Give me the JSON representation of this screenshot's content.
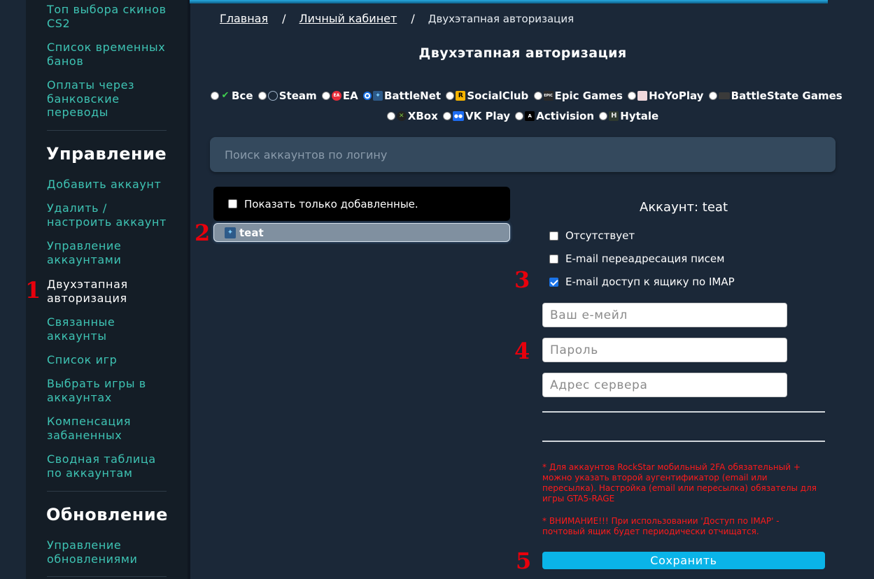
{
  "sidebar": {
    "links_top": [
      "Топ выбора скинов CS2",
      "Список временных банов",
      "Оплаты через банковские переводы"
    ],
    "heading_manage": "Управление",
    "links_manage": [
      "Добавить аккаунт",
      "Удалить / настроить аккаунт",
      "Управление аккаунтами",
      "Двухэтапная авторизация",
      "Связанные аккаунты",
      "Список игр",
      "Выбрать игры в аккаунтах",
      "Компенсация забаненных",
      "Сводная таблица по аккаунтам"
    ],
    "heading_update": "Обновление",
    "links_update": [
      "Управление обновлениями"
    ]
  },
  "markers": [
    "1",
    "2",
    "3",
    "4",
    "5"
  ],
  "breadcrumb": {
    "home": "Главная",
    "cabinet": "Личный кабинет",
    "separator": "/",
    "current": "Двухэтапная авторизация"
  },
  "page_title": "Двухэтапная авторизация",
  "platforms": {
    "row1": [
      "Все",
      "Steam",
      "EA",
      "BattleNet",
      "SocialClub",
      "Epic Games",
      "HoYoPlay",
      "BattleState Games"
    ],
    "row2": [
      "XBox",
      "VK Play",
      "Activision",
      "Hytale"
    ],
    "selected": "BattleNet"
  },
  "search": {
    "placeholder": "Поиск аккаунтов по логину"
  },
  "filter": {
    "label": "Показать только добавленные."
  },
  "accounts": [
    {
      "login": "teat"
    }
  ],
  "account_panel": {
    "title": "Аккаунт: teat",
    "options": [
      {
        "label": "Отсутствует",
        "checked": false
      },
      {
        "label": "E-mail переадресация писем",
        "checked": false
      },
      {
        "label": "E-mail доступ к ящику по IMAP",
        "checked": true
      }
    ],
    "email_placeholder": "Ваш е-мейл",
    "password_placeholder": "Пароль",
    "server_placeholder": "Адрес сервера",
    "note1": "* Для аккаунтов RockStar мобильный 2FA обязательный + можно указать второй аугентификатор (email или пересылка). Настройка (email или пересылка) обязателы для игры GTA5-RAGE",
    "note2": "* ВНИМАНИЕ!!! При использовании 'Доступ по IMAP' - почтовый ящик будет периодически отчищатся.",
    "save_label": "Сохранить"
  },
  "colors": {
    "accent": "#0ab4e8",
    "link": "#3ec4b4",
    "warning": "#ff1a1a",
    "marker": "#e8000c"
  }
}
